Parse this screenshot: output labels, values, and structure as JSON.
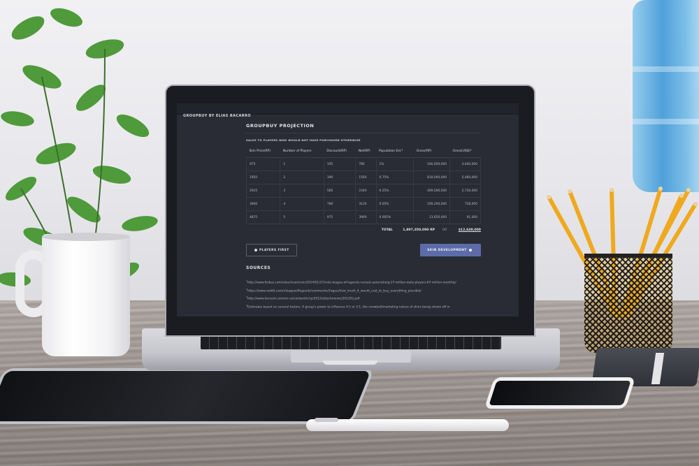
{
  "app": {
    "title": "GROUPBUY BY ELIAS BACARRO"
  },
  "projection": {
    "title": "GROUPBUY PROJECTION",
    "subtitle": "SALES TO PLAYERS WHO WOULD NOT HAVE PURCHASED OTHERWISE",
    "columns": [
      "Skin Price(RP)",
      "Number of Players",
      "Discount(RP)",
      "Net(RP)",
      "Population Est.⁴",
      "Gross(RP)",
      "Gross(USD)⁵"
    ],
    "rows": [
      [
        "975",
        "1",
        "195",
        "780",
        "1%",
        "546,000,000",
        "3,640,000"
      ],
      [
        "1950",
        "2",
        "390",
        "1560",
        "0.75%",
        "819,000,000",
        "5,460,000"
      ],
      [
        "2925",
        "3",
        "585",
        "2340",
        "0.25%",
        "409,500,000",
        "2,730,000"
      ],
      [
        "3900",
        "4",
        "780",
        "3120",
        "0.05%",
        "109,200,000",
        "728,000"
      ],
      [
        "4875",
        "5",
        "975",
        "3900",
        "0.005%",
        "13,650,000",
        "91,000"
      ]
    ],
    "total_label": "TOTAL",
    "total_rp": "1,897,350,000 RP",
    "total_or": "OR",
    "total_usd": "$12,649,000"
  },
  "buttons": {
    "players_first": "PLAYERS FIRST",
    "skin_development": "SKIN DEVELOPMENT"
  },
  "sources": {
    "title": "SOURCES",
    "items": [
      {
        "num": "1",
        "text": "http://www.forbes.com/sites/insertcoin/2014/01/27/riots-league-of-legends-reveals-astonishing-27-million-daily-players-67-million-monthly/"
      },
      {
        "num": "2",
        "text": "https://www.reddit.com/r/leagueoflegends/comments/2rqpss/how_much_it_would_cost_to_buy_everything_possible/"
      },
      {
        "num": "3",
        "text": "http://www.tencent.com/en-us/content/ir/rp/2012/attachments/201202.pdf"
      },
      {
        "num": "4",
        "text": "Estimates based on several factors. A group's power to influence 4:1 or 3:1, the snowball/marketing nature of skins being shown off in"
      }
    ]
  },
  "colors": {
    "screen_bg": "#2a2c35",
    "primary_button": "#5c6ca9",
    "pencil": "#f0a91e"
  }
}
